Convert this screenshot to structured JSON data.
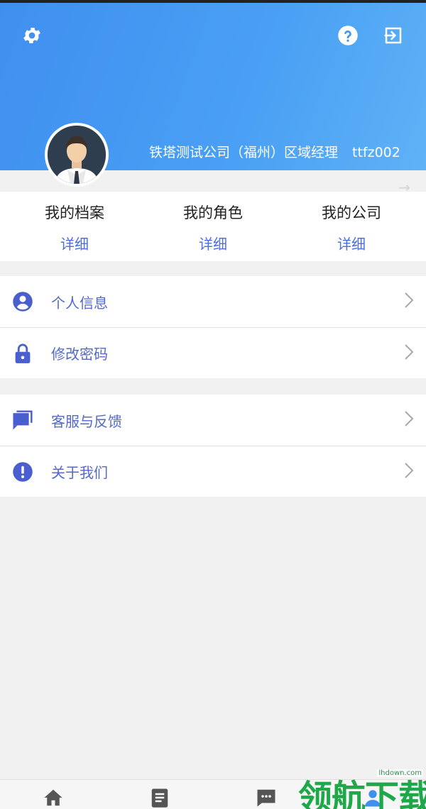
{
  "header": {
    "company_role": "铁塔测试公司（福州）区域经理",
    "user_id": "ttfz002"
  },
  "stats": [
    {
      "label": "我的档案",
      "link": "详细"
    },
    {
      "label": "我的角色",
      "link": "详细"
    },
    {
      "label": "我的公司",
      "link": "详细"
    }
  ],
  "menu": {
    "group1": [
      {
        "label": "个人信息",
        "icon": "person-circle-icon"
      },
      {
        "label": "修改密码",
        "icon": "lock-icon"
      }
    ],
    "group2": [
      {
        "label": "客服与反馈",
        "icon": "feedback-chat-icon"
      },
      {
        "label": "关于我们",
        "icon": "info-exclamation-icon"
      }
    ]
  },
  "bottom_nav": [
    "home-icon",
    "document-icon",
    "message-icon",
    "profile-icon"
  ],
  "watermark": {
    "text": "领航下载",
    "site": "lhdown.com"
  },
  "colors": {
    "header_start": "#3f8ff0",
    "header_end": "#5fb2f6",
    "accent": "#4b6ee0",
    "icon": "#4a5fcf",
    "watermark": "#1ea84a"
  }
}
